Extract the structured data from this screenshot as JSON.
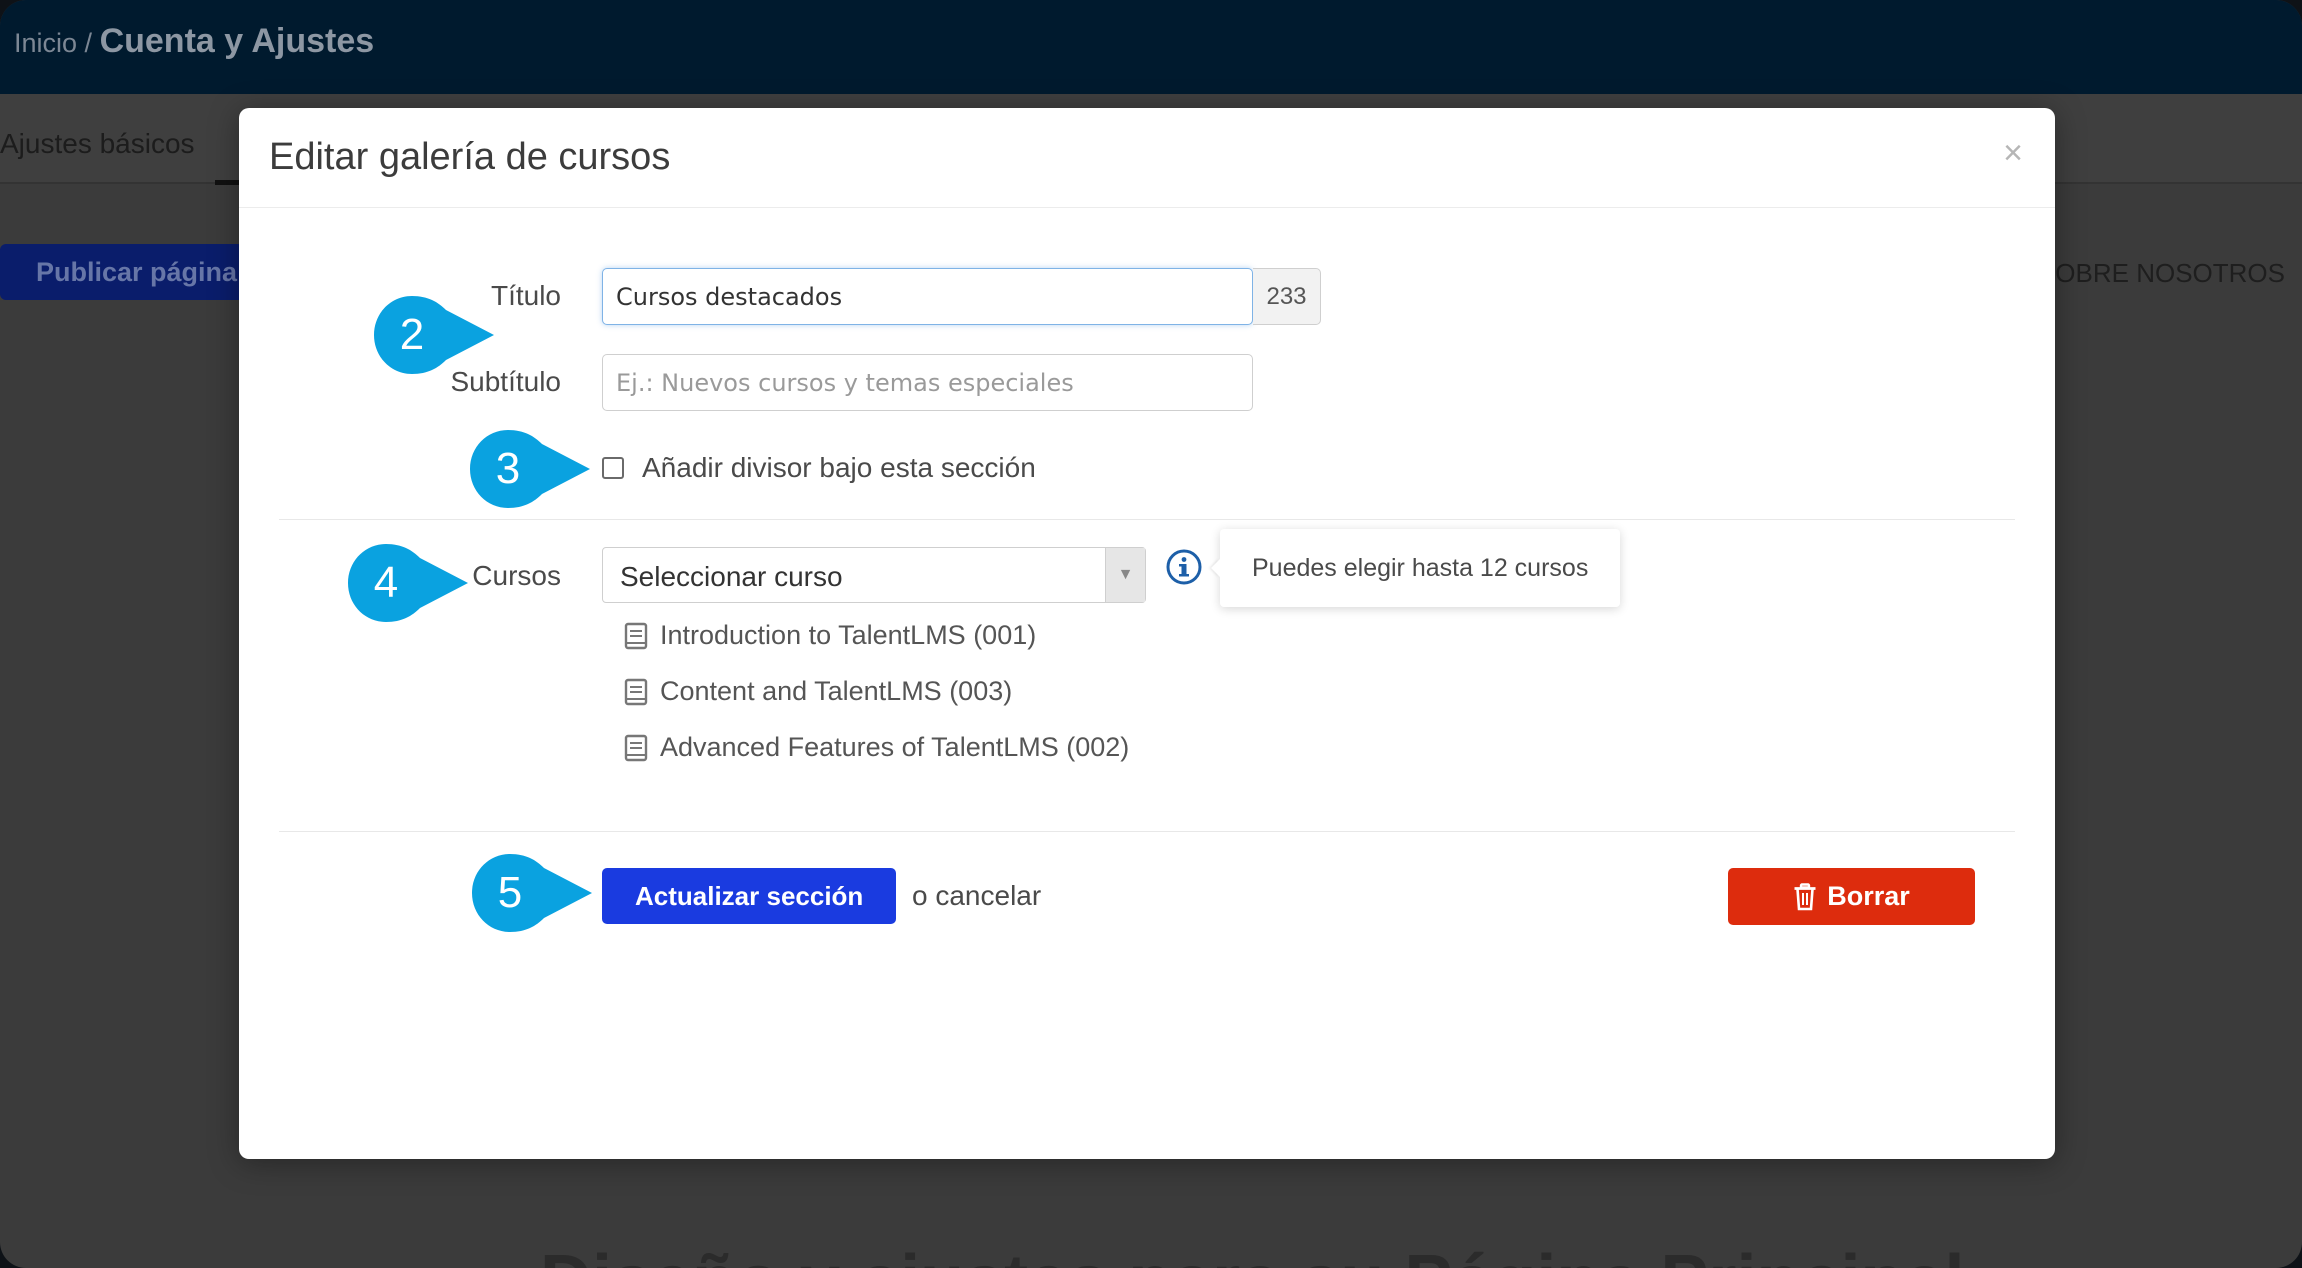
{
  "background": {
    "breadcrumb_home": "Inicio",
    "breadcrumb_sep": "/",
    "breadcrumb_current": "Cuenta y Ajustes",
    "tab_basic": "Ajustes básicos",
    "publish_button": "Publicar página",
    "about_link": "SOBRE NOSOTROS",
    "bottom_heading": "Diseño y ajustes para su Página Principal"
  },
  "modal": {
    "title": "Editar galería de cursos",
    "close_symbol": "×",
    "title_label": "Título",
    "title_value": "Cursos destacados",
    "title_counter": "233",
    "subtitle_label": "Subtítulo",
    "subtitle_placeholder": "Ej.: Nuevos cursos y temas especiales",
    "divider_checkbox_label": "Añadir divisor bajo esta sección",
    "courses_label": "Cursos",
    "courses_select_value": "Seleccionar curso",
    "courses_tooltip": "Puedes elegir hasta 12 cursos",
    "courses": [
      "Introduction to TalentLMS (001)",
      "Content and TalentLMS (003)",
      "Advanced Features of TalentLMS (002)"
    ],
    "update_button": "Actualizar sección",
    "cancel_text": "o cancelar",
    "delete_button": "Borrar"
  },
  "markers": [
    "2",
    "3",
    "4",
    "5"
  ],
  "colors": {
    "marker": "#0aa2e0",
    "primary": "#1a3be0",
    "danger": "#dd2c0d",
    "info_icon": "#1d5fa8"
  }
}
